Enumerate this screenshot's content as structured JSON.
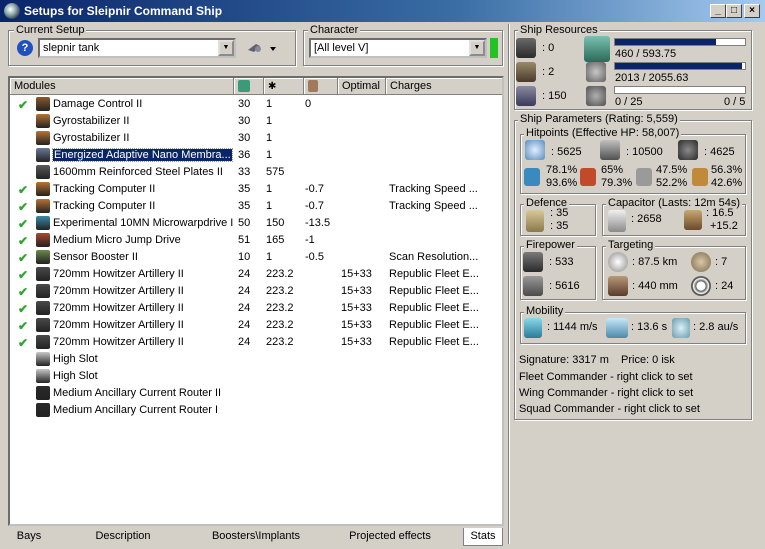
{
  "window": {
    "title": "Setups for Sleipnir Command Ship"
  },
  "setup": {
    "label": "Current Setup",
    "value": "slepnir tank"
  },
  "character": {
    "label": "Character",
    "value": "[All level V]"
  },
  "modules": {
    "headers": [
      "Modules",
      "",
      "",
      "",
      "Optimal",
      "Charges"
    ],
    "rows": [
      {
        "check": "✔",
        "name": "Damage Control II",
        "cpu": "30",
        "pg": "1",
        "cap": "0",
        "optimal": "",
        "charges": "",
        "color": "#8a5a2a"
      },
      {
        "check": "",
        "name": "Gyrostabilizer II",
        "cpu": "30",
        "pg": "1",
        "cap": "",
        "optimal": "",
        "charges": "",
        "color": "#b87333"
      },
      {
        "check": "",
        "name": "Gyrostabilizer II",
        "cpu": "30",
        "pg": "1",
        "cap": "",
        "optimal": "",
        "charges": "",
        "color": "#b87333"
      },
      {
        "check": "",
        "name": "Energized Adaptive Nano Membra...",
        "cpu": "36",
        "pg": "1",
        "cap": "",
        "optimal": "",
        "charges": "",
        "color": "#6a7a9a",
        "selected": true
      },
      {
        "check": "",
        "name": "1600mm Reinforced Steel Plates II",
        "cpu": "33",
        "pg": "575",
        "cap": "",
        "optimal": "",
        "charges": "",
        "color": "#5a5a5a"
      },
      {
        "check": "✔",
        "name": "Tracking Computer II",
        "cpu": "35",
        "pg": "1",
        "cap": "-0.7",
        "optimal": "",
        "charges": "Tracking Speed ...",
        "color": "#b87333"
      },
      {
        "check": "✔",
        "name": "Tracking Computer II",
        "cpu": "35",
        "pg": "1",
        "cap": "-0.7",
        "optimal": "",
        "charges": "Tracking Speed ...",
        "color": "#b87333"
      },
      {
        "check": "✔",
        "name": "Experimental 10MN Microwarpdrive I",
        "cpu": "50",
        "pg": "150",
        "cap": "-13.5",
        "optimal": "",
        "charges": "",
        "color": "#3a8aa8"
      },
      {
        "check": "✔",
        "name": "Medium Micro Jump Drive",
        "cpu": "51",
        "pg": "165",
        "cap": "-1",
        "optimal": "",
        "charges": "",
        "color": "#a84a2a"
      },
      {
        "check": "✔",
        "name": "Sensor Booster II",
        "cpu": "10",
        "pg": "1",
        "cap": "-0.5",
        "optimal": "",
        "charges": "Scan Resolution...",
        "color": "#6a8a4a"
      },
      {
        "check": "✔",
        "name": "720mm Howitzer Artillery II",
        "cpu": "24",
        "pg": "223.2",
        "cap": "",
        "optimal": "15+33",
        "charges": "Republic Fleet E...",
        "color": "#4a4a4a"
      },
      {
        "check": "✔",
        "name": "720mm Howitzer Artillery II",
        "cpu": "24",
        "pg": "223.2",
        "cap": "",
        "optimal": "15+33",
        "charges": "Republic Fleet E...",
        "color": "#4a4a4a"
      },
      {
        "check": "✔",
        "name": "720mm Howitzer Artillery II",
        "cpu": "24",
        "pg": "223.2",
        "cap": "",
        "optimal": "15+33",
        "charges": "Republic Fleet E...",
        "color": "#4a4a4a"
      },
      {
        "check": "✔",
        "name": "720mm Howitzer Artillery II",
        "cpu": "24",
        "pg": "223.2",
        "cap": "",
        "optimal": "15+33",
        "charges": "Republic Fleet E...",
        "color": "#4a4a4a"
      },
      {
        "check": "✔",
        "name": "720mm Howitzer Artillery II",
        "cpu": "24",
        "pg": "223.2",
        "cap": "",
        "optimal": "15+33",
        "charges": "Republic Fleet E...",
        "color": "#4a4a4a"
      },
      {
        "check": "",
        "name": "High Slot",
        "cpu": "",
        "pg": "",
        "cap": "",
        "optimal": "",
        "charges": "",
        "color": "#c8c8c8"
      },
      {
        "check": "",
        "name": "High Slot",
        "cpu": "",
        "pg": "",
        "cap": "",
        "optimal": "",
        "charges": "",
        "color": "#c8c8c8"
      },
      {
        "check": "",
        "name": "Medium Ancillary Current Router II",
        "cpu": "",
        "pg": "",
        "cap": "",
        "optimal": "",
        "charges": "",
        "color": "#2a2a2a"
      },
      {
        "check": "",
        "name": "Medium Ancillary Current Router I",
        "cpu": "",
        "pg": "",
        "cap": "",
        "optimal": "",
        "charges": "",
        "color": "#2a2a2a"
      }
    ]
  },
  "tabs": [
    "Bays",
    "Description",
    "Boosters\\Implants",
    "Projected effects",
    "Stats"
  ],
  "resources": {
    "label": "Ship Resources",
    "turrets": ": 0",
    "launchers": ": 2",
    "calibration": ": 150",
    "cpu": "460 / 593.75",
    "cpu_fraction": 0.775,
    "powergrid": "2013 / 2055.63",
    "pg_fraction": 0.979,
    "drone_bay": "0 / 25",
    "drone_bw": "0 / 5"
  },
  "params": {
    "label": "Ship Parameters (Rating: 5,559)",
    "hitpoints": {
      "label": "Hitpoints (Effective HP: 58,007)",
      "shield": ": 5625",
      "armor": ": 10500",
      "hull": ": 4625",
      "res": [
        [
          "78.1%",
          "93.6%"
        ],
        [
          "65%",
          "79.3%"
        ],
        [
          "47.5%",
          "52.2%"
        ],
        [
          "56.3%",
          "42.6%"
        ]
      ]
    },
    "defence": {
      "label": "Defence",
      "a": ": 35",
      "b": ": 35"
    },
    "capacitor": {
      "label": "Capacitor (Lasts: 12m 54s)",
      "amount": ": 2658",
      "recharge1": ": 16.5",
      "recharge2": "+15.2"
    },
    "firepower": {
      "label": "Firepower",
      "volley": ": 533",
      "dps": ": 5616"
    },
    "targeting": {
      "label": "Targeting",
      "range": ": 87.5 km",
      "targets": ": 7",
      "scanres": ": 440 mm",
      "sensor": ": 24"
    },
    "mobility": {
      "label": "Mobility",
      "speed": ": 1144 m/s",
      "align": ": 13.6 s",
      "warp": ": 2.8 au/s"
    },
    "signature": "Signature: 3317 m",
    "price": "Price: 0 isk",
    "fleet": "Fleet Commander - right click to set",
    "wing": "Wing Commander - right click to set",
    "squad": "Squad Commander - right click to set"
  }
}
